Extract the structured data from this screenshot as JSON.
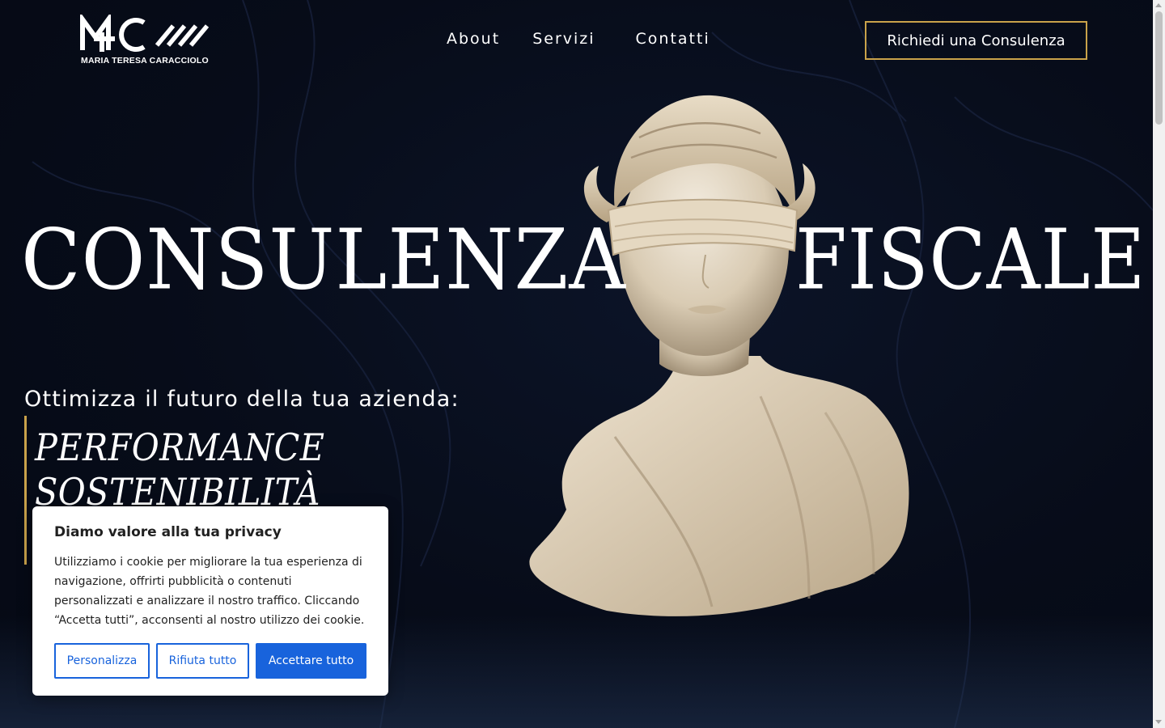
{
  "header": {
    "logo_caption": "MARIA TERESA CARACCIOLO",
    "nav": [
      {
        "label": "About"
      },
      {
        "label": "Servizi"
      },
      {
        "label": "Contatti"
      }
    ],
    "cta_label": "Richiedi una Consulenza"
  },
  "hero": {
    "title_left": "CONSULENZA",
    "title_right": "FISCALE",
    "subtitle": "Ottimizza il futuro della tua azienda:",
    "tagline_1": "PERFORMANCE",
    "tagline_2": "SOSTENIBILITÀ"
  },
  "cookie_banner": {
    "title": "Diamo valore alla tua privacy",
    "text": "Utilizziamo i cookie per migliorare la tua esperienza di navigazione, offrirti pubblicità o contenuti personalizzati e analizzare il nostro traffico. Cliccando “Accetta tutti”, acconsenti al nostro utilizzo dei cookie.",
    "customize_label": "Personalizza",
    "reject_label": "Rifiuta tutto",
    "accept_label": "Accettare tutto"
  },
  "colors": {
    "background": "#060b18",
    "accent_gold": "#c9a24a",
    "cookie_blue": "#1863dc"
  },
  "icons": [
    "mtc-logo",
    "statue-image"
  ]
}
